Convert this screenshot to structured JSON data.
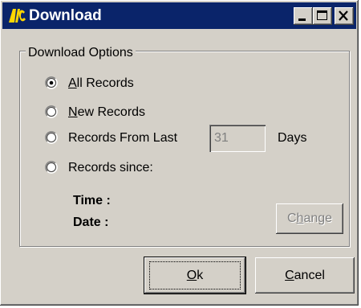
{
  "window": {
    "title": "Download",
    "app_icon": "alc-app-icon",
    "controls": [
      "minimize",
      "maximize",
      "close"
    ]
  },
  "group": {
    "legend": "Download Options",
    "options": [
      {
        "mnemonic": "A",
        "rest": "ll Records",
        "checked": true
      },
      {
        "mnemonic": "N",
        "rest": "ew Records",
        "checked": false
      },
      {
        "mnemonic": "",
        "rest": "Records From Last",
        "checked": false
      },
      {
        "mnemonic": "",
        "rest": "Records since:",
        "checked": false
      }
    ],
    "days_value": "31",
    "days_unit": "Days",
    "time_label": "Time :",
    "date_label": "Date :",
    "change_button": {
      "before": "C",
      "mnemonic": "h",
      "after": "ange",
      "enabled": false
    }
  },
  "buttons": {
    "ok": {
      "mnemonic": "O",
      "rest": "k"
    },
    "cancel": {
      "mnemonic": "C",
      "rest": "ancel"
    }
  },
  "colors": {
    "titlebar": "#0a246a",
    "face": "#d4d0c8",
    "icon_yellow": "#ffd700"
  }
}
